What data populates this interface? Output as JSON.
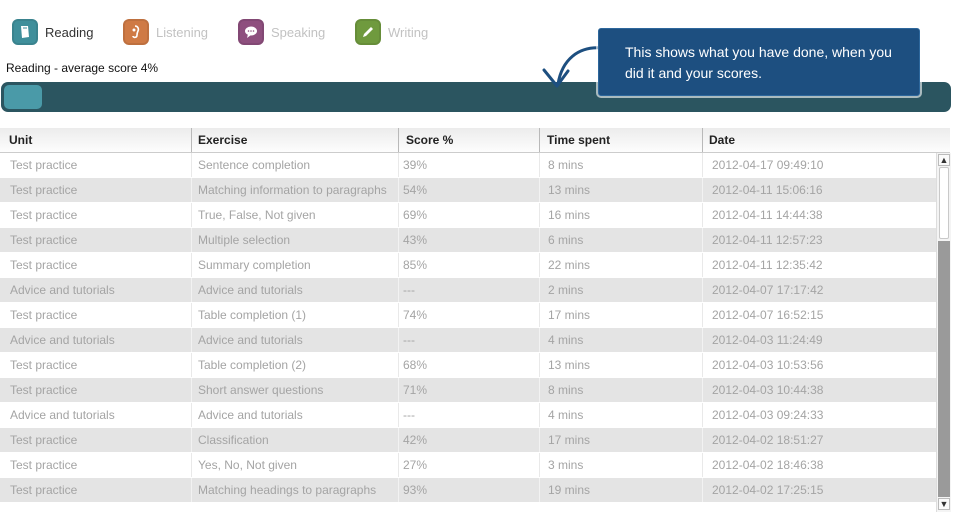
{
  "tabs": [
    {
      "label": "Reading",
      "icon": "reading-icon",
      "color": "#3f8f9b",
      "active": true
    },
    {
      "label": "Listening",
      "icon": "listening-icon",
      "color": "#cf7a45",
      "active": false
    },
    {
      "label": "Speaking",
      "icon": "speaking-icon",
      "color": "#8e4f7e",
      "active": false
    },
    {
      "label": "Writing",
      "icon": "writing-icon",
      "color": "#6f9a3e",
      "active": false
    }
  ],
  "summary": "Reading - average score 4%",
  "progress": {
    "percent": 4
  },
  "callout": "This shows what you have done, when you did it and your scores.",
  "table": {
    "headers": [
      "Unit",
      "Exercise",
      "Score %",
      "Time spent",
      "Date"
    ],
    "rows": [
      [
        "Test practice",
        "Sentence completion",
        "39%",
        "8 mins",
        "2012-04-17 09:49:10"
      ],
      [
        "Test practice",
        "Matching information to paragraphs",
        "54%",
        "13 mins",
        "2012-04-11 15:06:16"
      ],
      [
        "Test practice",
        "True, False, Not given",
        "69%",
        "16 mins",
        "2012-04-11 14:44:38"
      ],
      [
        "Test practice",
        "Multiple selection",
        "43%",
        "6 mins",
        "2012-04-11 12:57:23"
      ],
      [
        "Test practice",
        "Summary completion",
        "85%",
        "22 mins",
        "2012-04-11 12:35:42"
      ],
      [
        "Advice and tutorials",
        "Advice and tutorials",
        "---",
        "2 mins",
        "2012-04-07 17:17:42"
      ],
      [
        "Test practice",
        "Table completion (1)",
        "74%",
        "17 mins",
        "2012-04-07 16:52:15"
      ],
      [
        "Advice and tutorials",
        "Advice and tutorials",
        "---",
        "4 mins",
        "2012-04-03 11:24:49"
      ],
      [
        "Test practice",
        "Table completion (2)",
        "68%",
        "13 mins",
        "2012-04-03 10:53:56"
      ],
      [
        "Test practice",
        "Short answer questions",
        "71%",
        "8 mins",
        "2012-04-03 10:44:38"
      ],
      [
        "Advice and tutorials",
        "Advice and tutorials",
        "---",
        "4 mins",
        "2012-04-03 09:24:33"
      ],
      [
        "Test practice",
        "Classification",
        "42%",
        "17 mins",
        "2012-04-02 18:51:27"
      ],
      [
        "Test practice",
        "Yes, No, Not given",
        "27%",
        "3 mins",
        "2012-04-02 18:46:38"
      ],
      [
        "Test practice",
        "Matching headings to paragraphs",
        "93%",
        "19 mins",
        "2012-04-02 17:25:15"
      ]
    ]
  },
  "scroll": {
    "up": "▲",
    "down": "▼"
  }
}
